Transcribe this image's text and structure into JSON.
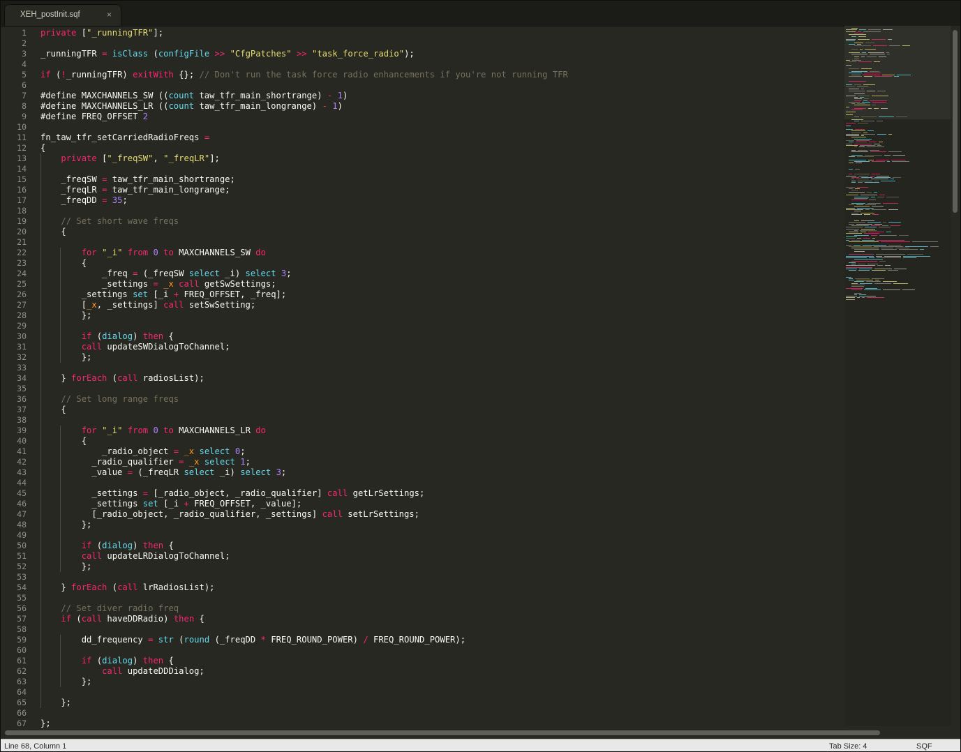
{
  "tab": {
    "title": "XEH_postInit.sqf",
    "close_glyph": "×"
  },
  "status": {
    "position": "Line 68, Column 1",
    "tab_size": "Tab Size: 4",
    "syntax": "SQF"
  },
  "colors": {
    "background": "#272822",
    "text": "#f8f8f2",
    "keyword": "#f92672",
    "function": "#66d9ef",
    "string": "#e6db74",
    "number": "#ae81ff",
    "comment": "#75715e",
    "line_number": "#8f908a"
  },
  "lines": [
    [
      [
        "private ",
        "kw"
      ],
      [
        "[",
        ""
      ],
      [
        "\"_runningTFR\"",
        "str"
      ],
      [
        "];",
        ""
      ]
    ],
    [],
    [
      [
        "_runningTFR ",
        ""
      ],
      [
        "=",
        "op"
      ],
      [
        " ",
        ""
      ],
      [
        "isClass",
        "fn"
      ],
      [
        " (",
        ""
      ],
      [
        "configFile",
        "fn"
      ],
      [
        " ",
        ""
      ],
      [
        ">>",
        "op"
      ],
      [
        " ",
        ""
      ],
      [
        "\"CfgPatches\"",
        "str"
      ],
      [
        " ",
        ""
      ],
      [
        ">>",
        "op"
      ],
      [
        " ",
        ""
      ],
      [
        "\"task_force_radio\"",
        "str"
      ],
      [
        ");",
        ""
      ]
    ],
    [],
    [
      [
        "if",
        "kw"
      ],
      [
        " (",
        ""
      ],
      [
        "!",
        "op"
      ],
      [
        "_runningTFR) ",
        ""
      ],
      [
        "exitWith",
        "kw"
      ],
      [
        " {}; ",
        ""
      ],
      [
        "// Don't run the task force radio enhancements if you're not running TFR",
        "cm"
      ]
    ],
    [],
    [
      [
        "#define MAXCHANNELS_SW ((",
        ""
      ],
      [
        "count",
        "fn"
      ],
      [
        " taw_tfr_main_shortrange) ",
        ""
      ],
      [
        "-",
        "op"
      ],
      [
        " ",
        ""
      ],
      [
        "1",
        "num"
      ],
      [
        ")",
        ""
      ]
    ],
    [
      [
        "#define MAXCHANNELS_LR ((",
        ""
      ],
      [
        "count",
        "fn"
      ],
      [
        " taw_tfr_main_longrange) ",
        ""
      ],
      [
        "-",
        "op"
      ],
      [
        " ",
        ""
      ],
      [
        "1",
        "num"
      ],
      [
        ")",
        ""
      ]
    ],
    [
      [
        "#define FREQ_OFFSET ",
        ""
      ],
      [
        "2",
        "num"
      ]
    ],
    [],
    [
      [
        "fn_taw_tfr_setCarriedRadioFreqs ",
        ""
      ],
      [
        "=",
        "op"
      ]
    ],
    [
      [
        "{",
        ""
      ]
    ],
    [
      [
        "    ",
        ""
      ],
      [
        "private",
        "kw"
      ],
      [
        " [",
        ""
      ],
      [
        "\"_freqSW\"",
        "str"
      ],
      [
        ", ",
        ""
      ],
      [
        "\"_freqLR\"",
        "str"
      ],
      [
        "];",
        ""
      ]
    ],
    [],
    [
      [
        "    _freqSW ",
        ""
      ],
      [
        "=",
        "op"
      ],
      [
        " taw_tfr_main_shortrange;",
        ""
      ]
    ],
    [
      [
        "    _freqLR ",
        ""
      ],
      [
        "=",
        "op"
      ],
      [
        " taw_tfr_main_longrange;",
        ""
      ]
    ],
    [
      [
        "    _freqDD ",
        ""
      ],
      [
        "=",
        "op"
      ],
      [
        " ",
        ""
      ],
      [
        "35",
        "num"
      ],
      [
        ";",
        ""
      ]
    ],
    [],
    [
      [
        "    ",
        ""
      ],
      [
        "// Set short wave freqs",
        "cm"
      ]
    ],
    [
      [
        "    {",
        ""
      ]
    ],
    [],
    [
      [
        "        ",
        ""
      ],
      [
        "for",
        "kw"
      ],
      [
        " ",
        ""
      ],
      [
        "\"_i\"",
        "str"
      ],
      [
        " ",
        ""
      ],
      [
        "from",
        "kw"
      ],
      [
        " ",
        ""
      ],
      [
        "0",
        "num"
      ],
      [
        " ",
        ""
      ],
      [
        "to",
        "kw"
      ],
      [
        " MAXCHANNELS_SW ",
        ""
      ],
      [
        "do",
        "kw"
      ]
    ],
    [
      [
        "        {",
        ""
      ]
    ],
    [
      [
        "            _freq ",
        ""
      ],
      [
        "=",
        "op"
      ],
      [
        " (_freqSW ",
        ""
      ],
      [
        "select",
        "fn"
      ],
      [
        " _i) ",
        ""
      ],
      [
        "select",
        "fn"
      ],
      [
        " ",
        ""
      ],
      [
        "3",
        "num"
      ],
      [
        ";",
        ""
      ]
    ],
    [
      [
        "            _settings ",
        ""
      ],
      [
        "=",
        "op"
      ],
      [
        " ",
        ""
      ],
      [
        "_x",
        "vr"
      ],
      [
        " ",
        ""
      ],
      [
        "call",
        "kw"
      ],
      [
        " getSwSettings;",
        ""
      ]
    ],
    [
      [
        "        _settings ",
        ""
      ],
      [
        "set",
        "fn"
      ],
      [
        " [_i ",
        ""
      ],
      [
        "+",
        "op"
      ],
      [
        " FREQ_OFFSET, _freq];",
        ""
      ]
    ],
    [
      [
        "        [",
        ""
      ],
      [
        "_x",
        "vr"
      ],
      [
        ", _settings] ",
        ""
      ],
      [
        "call",
        "kw"
      ],
      [
        " setSwSetting;",
        ""
      ]
    ],
    [
      [
        "        };",
        ""
      ]
    ],
    [],
    [
      [
        "        ",
        ""
      ],
      [
        "if",
        "kw"
      ],
      [
        " (",
        ""
      ],
      [
        "dialog",
        "fn"
      ],
      [
        ") ",
        ""
      ],
      [
        "then",
        "kw"
      ],
      [
        " {",
        ""
      ]
    ],
    [
      [
        "        ",
        ""
      ],
      [
        "call",
        "kw"
      ],
      [
        " updateSWDialogToChannel;",
        ""
      ]
    ],
    [
      [
        "        };",
        ""
      ]
    ],
    [],
    [
      [
        "    } ",
        ""
      ],
      [
        "forEach",
        "kw"
      ],
      [
        " (",
        ""
      ],
      [
        "call",
        "kw"
      ],
      [
        " radiosList);",
        ""
      ]
    ],
    [],
    [
      [
        "    ",
        ""
      ],
      [
        "// Set long range freqs",
        "cm"
      ]
    ],
    [
      [
        "    {",
        ""
      ]
    ],
    [],
    [
      [
        "        ",
        ""
      ],
      [
        "for",
        "kw"
      ],
      [
        " ",
        ""
      ],
      [
        "\"_i\"",
        "str"
      ],
      [
        " ",
        ""
      ],
      [
        "from",
        "kw"
      ],
      [
        " ",
        ""
      ],
      [
        "0",
        "num"
      ],
      [
        " ",
        ""
      ],
      [
        "to",
        "kw"
      ],
      [
        " MAXCHANNELS_LR ",
        ""
      ],
      [
        "do",
        "kw"
      ]
    ],
    [
      [
        "        {",
        ""
      ]
    ],
    [
      [
        "            _radio_object ",
        ""
      ],
      [
        "=",
        "op"
      ],
      [
        " ",
        ""
      ],
      [
        "_x",
        "vr"
      ],
      [
        " ",
        ""
      ],
      [
        "select",
        "fn"
      ],
      [
        " ",
        ""
      ],
      [
        "0",
        "num"
      ],
      [
        ";",
        ""
      ]
    ],
    [
      [
        "          _radio_qualifier ",
        ""
      ],
      [
        "=",
        "op"
      ],
      [
        " ",
        ""
      ],
      [
        "_x",
        "vr"
      ],
      [
        " ",
        ""
      ],
      [
        "select",
        "fn"
      ],
      [
        " ",
        ""
      ],
      [
        "1",
        "num"
      ],
      [
        ";",
        ""
      ]
    ],
    [
      [
        "          _value ",
        ""
      ],
      [
        "=",
        "op"
      ],
      [
        " (_freqLR ",
        ""
      ],
      [
        "select",
        "fn"
      ],
      [
        " _i) ",
        ""
      ],
      [
        "select",
        "fn"
      ],
      [
        " ",
        ""
      ],
      [
        "3",
        "num"
      ],
      [
        ";",
        ""
      ]
    ],
    [],
    [
      [
        "          _settings ",
        ""
      ],
      [
        "=",
        "op"
      ],
      [
        " [_radio_object, _radio_qualifier] ",
        ""
      ],
      [
        "call",
        "kw"
      ],
      [
        " getLrSettings;",
        ""
      ]
    ],
    [
      [
        "          _settings ",
        ""
      ],
      [
        "set",
        "fn"
      ],
      [
        " [_i ",
        ""
      ],
      [
        "+",
        "op"
      ],
      [
        " FREQ_OFFSET, _value];",
        ""
      ]
    ],
    [
      [
        "          [_radio_object, _radio_qualifier, _settings] ",
        ""
      ],
      [
        "call",
        "kw"
      ],
      [
        " setLrSettings;",
        ""
      ]
    ],
    [
      [
        "        };",
        ""
      ]
    ],
    [],
    [
      [
        "        ",
        ""
      ],
      [
        "if",
        "kw"
      ],
      [
        " (",
        ""
      ],
      [
        "dialog",
        "fn"
      ],
      [
        ") ",
        ""
      ],
      [
        "then",
        "kw"
      ],
      [
        " {",
        ""
      ]
    ],
    [
      [
        "        ",
        ""
      ],
      [
        "call",
        "kw"
      ],
      [
        " updateLRDialogToChannel;",
        ""
      ]
    ],
    [
      [
        "        };",
        ""
      ]
    ],
    [],
    [
      [
        "    } ",
        ""
      ],
      [
        "forEach",
        "kw"
      ],
      [
        " (",
        ""
      ],
      [
        "call",
        "kw"
      ],
      [
        " lrRadiosList);",
        ""
      ]
    ],
    [],
    [
      [
        "    ",
        ""
      ],
      [
        "// Set diver radio freq",
        "cm"
      ]
    ],
    [
      [
        "    ",
        ""
      ],
      [
        "if",
        "kw"
      ],
      [
        " (",
        ""
      ],
      [
        "call",
        "kw"
      ],
      [
        " haveDDRadio) ",
        ""
      ],
      [
        "then",
        "kw"
      ],
      [
        " {",
        ""
      ]
    ],
    [],
    [
      [
        "        dd_frequency ",
        ""
      ],
      [
        "=",
        "op"
      ],
      [
        " ",
        ""
      ],
      [
        "str",
        "fn"
      ],
      [
        " (",
        ""
      ],
      [
        "round",
        "fn"
      ],
      [
        " (_freqDD ",
        ""
      ],
      [
        "*",
        "op"
      ],
      [
        " FREQ_ROUND_POWER) ",
        ""
      ],
      [
        "/",
        "op"
      ],
      [
        " FREQ_ROUND_POWER);",
        ""
      ]
    ],
    [],
    [
      [
        "        ",
        ""
      ],
      [
        "if",
        "kw"
      ],
      [
        " (",
        ""
      ],
      [
        "dialog",
        "fn"
      ],
      [
        ") ",
        ""
      ],
      [
        "then",
        "kw"
      ],
      [
        " {",
        ""
      ]
    ],
    [
      [
        "            ",
        ""
      ],
      [
        "call",
        "kw"
      ],
      [
        " updateDDDialog;",
        ""
      ]
    ],
    [
      [
        "        };",
        ""
      ]
    ],
    [],
    [
      [
        "    };",
        ""
      ]
    ],
    [],
    [
      [
        "};",
        ""
      ]
    ]
  ]
}
